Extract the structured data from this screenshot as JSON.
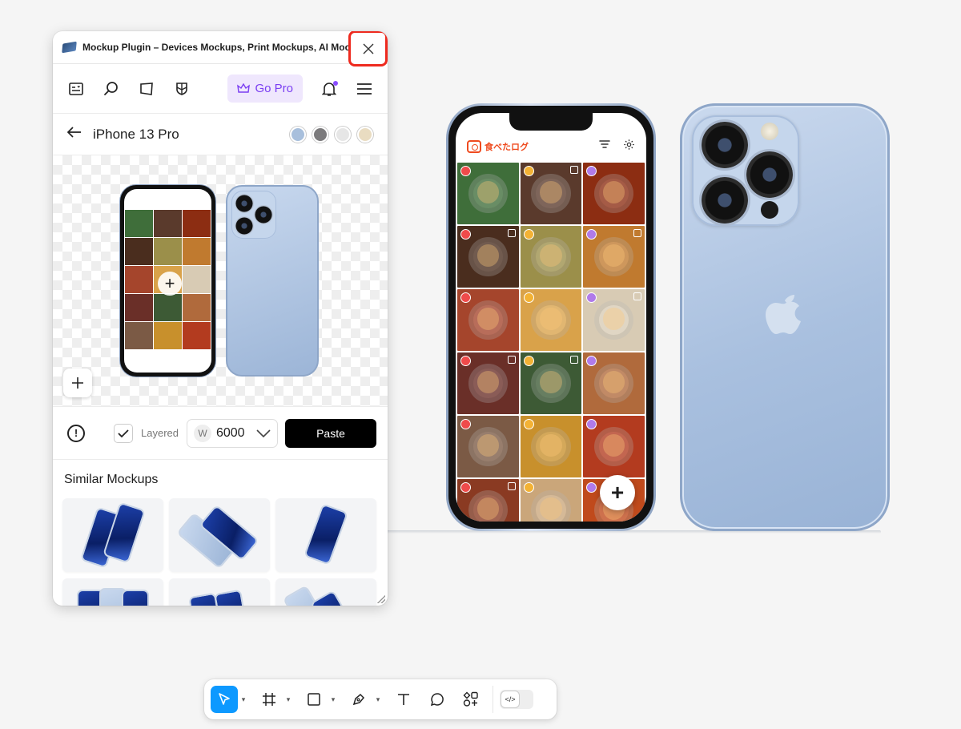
{
  "plugin": {
    "title": "Mockup Plugin – Devices Mockups, Print Mockups, AI Mock...",
    "toolbar": {
      "icons": [
        "layout-icon",
        "search-icon",
        "shape-icon",
        "shield-icon"
      ],
      "go_pro_label": "Go Pro"
    },
    "device": {
      "name": "iPhone 13 Pro",
      "colors": [
        "#a8bfdc",
        "#7b7a7c",
        "#e6e6e6",
        "#e9dcc1"
      ]
    },
    "controls": {
      "layered_label": "Layered",
      "width_tag": "W",
      "width_value": "6000",
      "paste_label": "Paste"
    },
    "similar_title": "Similar Mockups"
  },
  "app_preview": {
    "app_name": "食べたログ",
    "fab_label": "+"
  },
  "bottom_toolbar": {
    "tools": [
      "move-tool",
      "frame-tool",
      "rectangle-tool",
      "pen-tool",
      "text-tool",
      "comment-tool",
      "actions-tool"
    ],
    "dev_mode_label": "</>"
  },
  "colors": {
    "accent": "#0d99ff",
    "close_highlight": "#ee2a1f",
    "pro_purple": "#7b3ff2",
    "app_orange": "#ef4b1f"
  }
}
